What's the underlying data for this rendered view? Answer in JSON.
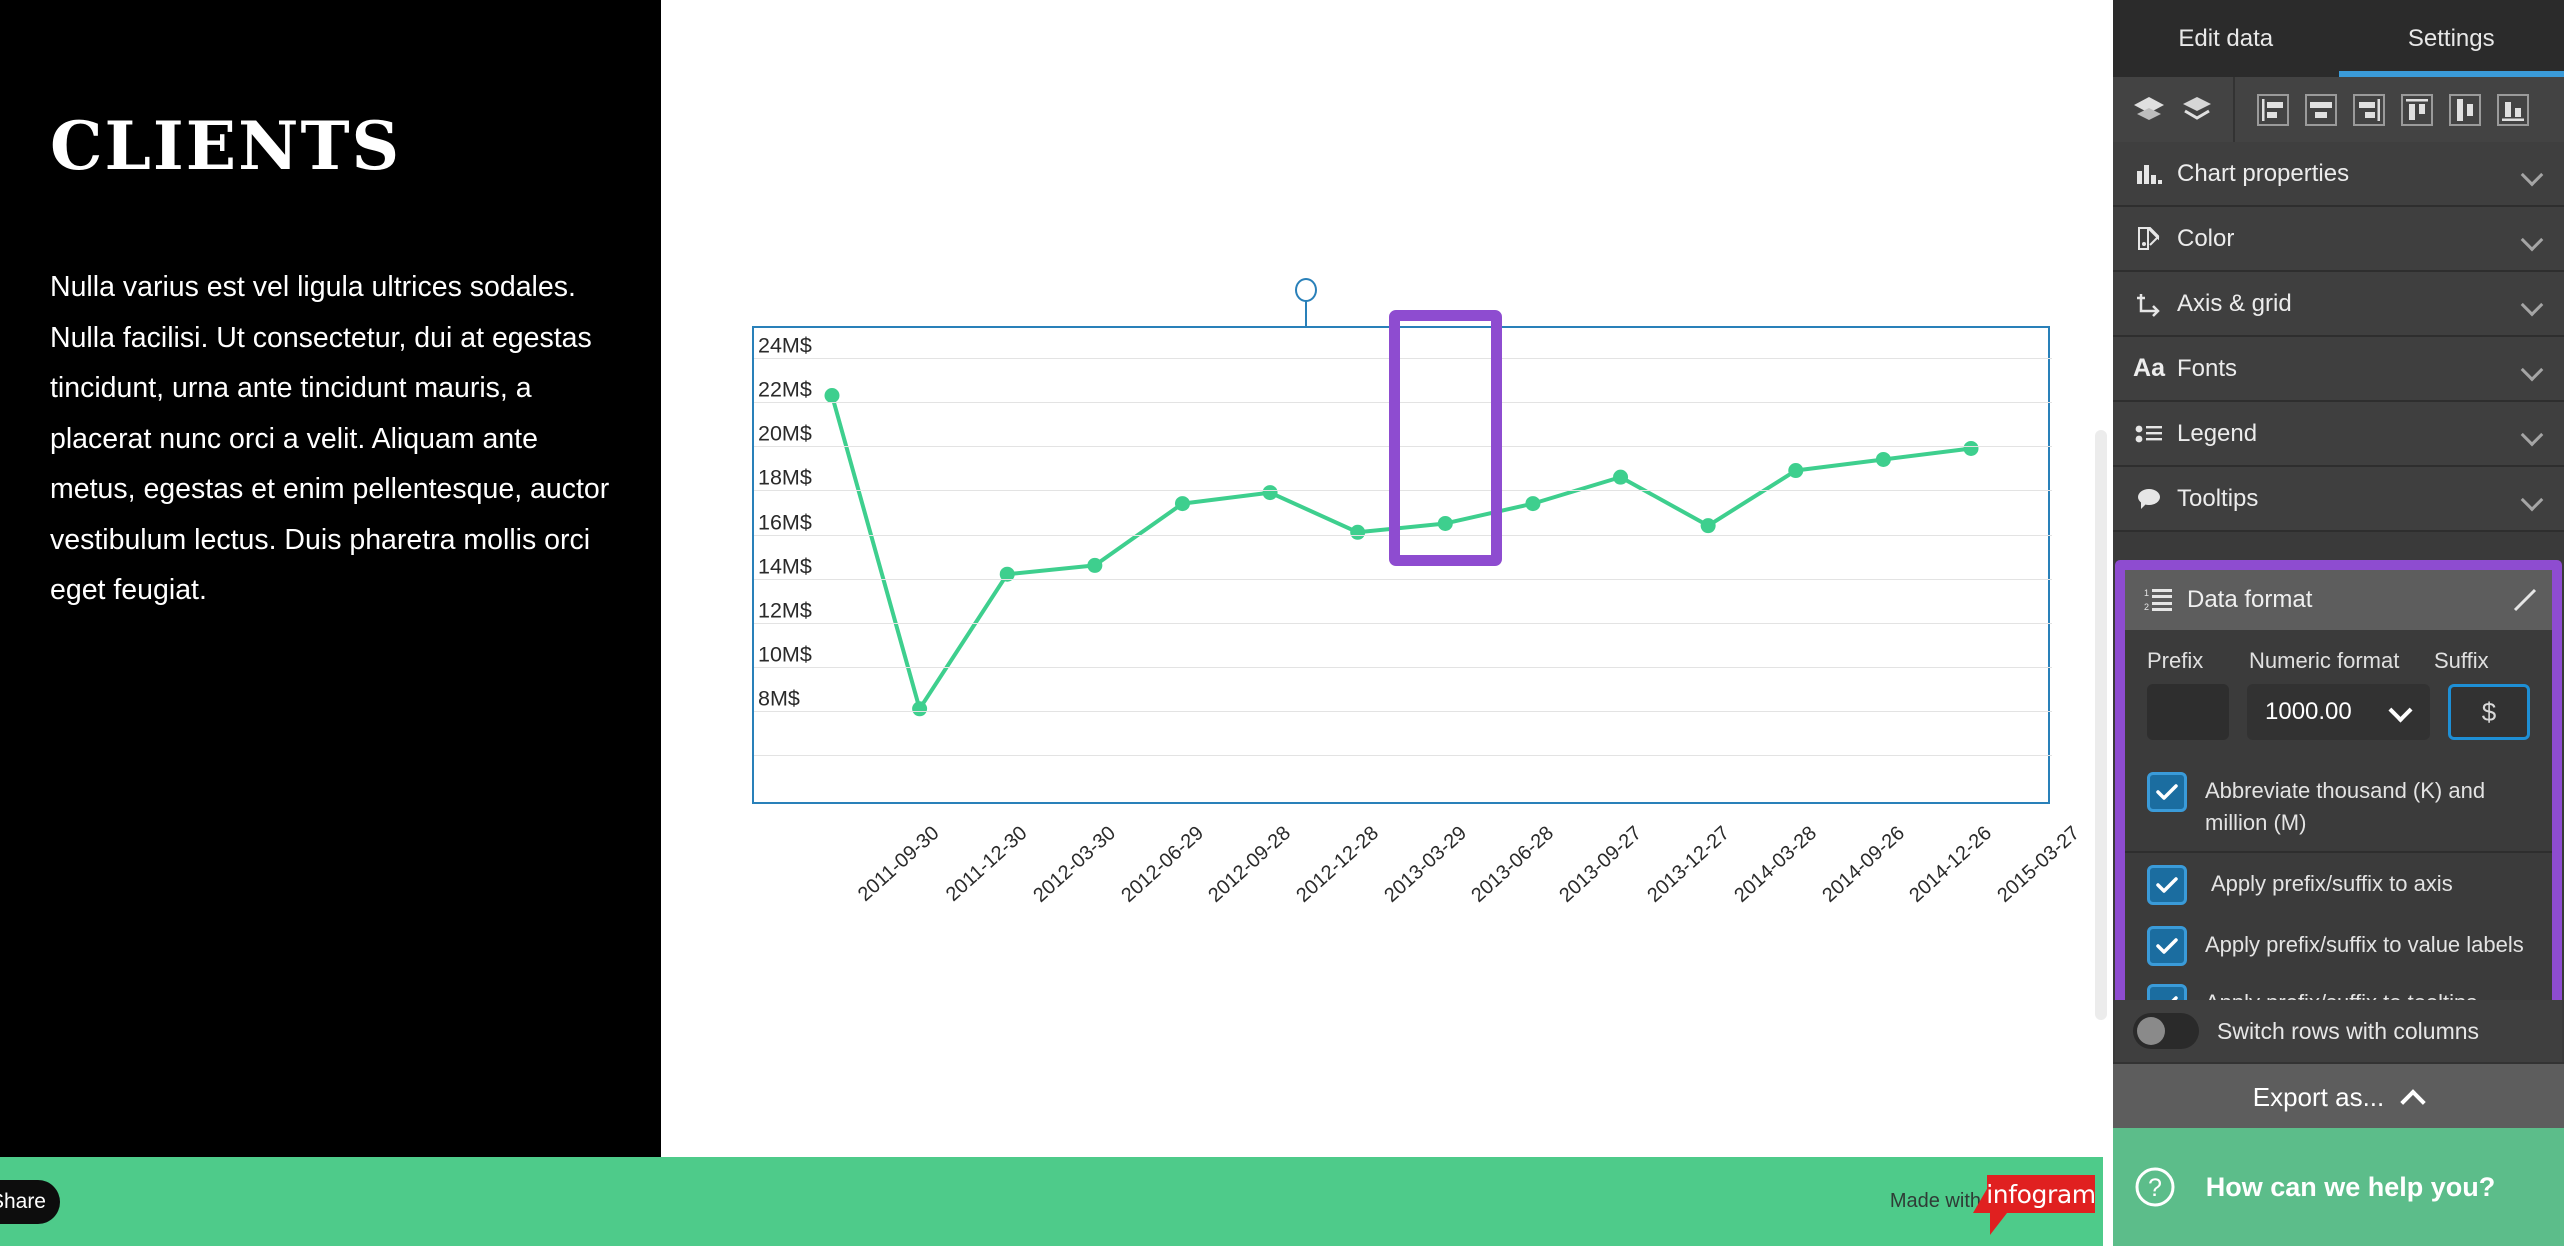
{
  "left_panel": {
    "title": "CLIENTS",
    "body": "Nulla varius est vel ligula ultrices sodales. Nulla facilisi. Ut consectetur, dui at egestas tincidunt, urna ante tincidunt mauris, a placerat nunc orci a velit. Aliquam ante metus, egestas et enim pellentesque, auctor vestibulum lectus. Duis pharetra mollis orci eget feugiat."
  },
  "footer": {
    "share_label": "Share",
    "made_with": "Made with",
    "brand": "infogram"
  },
  "right_panel": {
    "tabs": [
      {
        "label": "Edit data",
        "active": false
      },
      {
        "label": "Settings",
        "active": true
      }
    ],
    "toolbar_icons": [
      "bring-forward-icon",
      "send-backward-icon",
      "align-left-icon",
      "align-center-icon",
      "align-right-icon",
      "align-top-icon",
      "align-middle-icon",
      "align-bottom-icon"
    ],
    "menu_items": [
      {
        "label": "Chart properties",
        "icon": "bar-chart-icon"
      },
      {
        "label": "Color",
        "icon": "color-swatch-icon"
      },
      {
        "label": "Axis & grid",
        "icon": "axis-grid-icon"
      },
      {
        "label": "Fonts",
        "icon": "font-aa-icon"
      },
      {
        "label": "Legend",
        "icon": "legend-list-icon"
      },
      {
        "label": "Tooltips",
        "icon": "tooltip-bubble-icon"
      }
    ],
    "data_format": {
      "title": "Data format",
      "icon": "numbered-list-icon",
      "edit_icon": "pencil-icon",
      "column_labels": {
        "prefix": "Prefix",
        "numeric": "Numeric format",
        "suffix": "Suffix"
      },
      "prefix_value": "",
      "numeric_value": "1000.00",
      "suffix_value": "$",
      "checkboxes": [
        {
          "label": "Abbreviate thousand (K) and million (M)",
          "checked": true
        },
        {
          "label": "Apply prefix/suffix to axis",
          "checked": true
        },
        {
          "label": "Apply prefix/suffix to value labels",
          "checked": true
        },
        {
          "label": "Apply prefix/suffix to tooltips",
          "checked": true
        }
      ]
    },
    "switch_rows_label": "Switch rows with columns",
    "switch_rows_on": false,
    "export_label": "Export as...",
    "help_label": "How can we help you?",
    "accent_blue": "#3a9bd9",
    "highlight_purple": "#8e4cd0",
    "panel_bg": "#3a3a3a"
  },
  "chart_data": {
    "type": "line",
    "title": "",
    "xlabel": "",
    "ylabel": "",
    "ylim": [
      7,
      25
    ],
    "yticks": [
      8,
      10,
      12,
      14,
      16,
      18,
      20,
      22,
      24
    ],
    "ytick_labels": [
      "8M$",
      "10M$",
      "12M$",
      "14M$",
      "16M$",
      "18M$",
      "20M$",
      "22M$",
      "24M$"
    ],
    "grid": true,
    "legend": "none",
    "line_color": "#3ecf8e",
    "marker_color": "#3ecf8e",
    "categories": [
      "2011-09-30",
      "2011-12-30",
      "2012-03-30",
      "2012-06-29",
      "2012-09-28",
      "2012-12-28",
      "2013-03-29",
      "2013-06-28",
      "2013-09-27",
      "2013-12-27",
      "2014-03-28",
      "2014-09-26",
      "2014-12-26",
      "2015-03-27"
    ],
    "series": [
      {
        "name": "Clients",
        "values": [
          22.3,
          8.1,
          14.2,
          14.6,
          17.4,
          17.9,
          16.1,
          16.5,
          17.4,
          18.6,
          16.4,
          18.9,
          19.4,
          19.9
        ]
      }
    ]
  }
}
